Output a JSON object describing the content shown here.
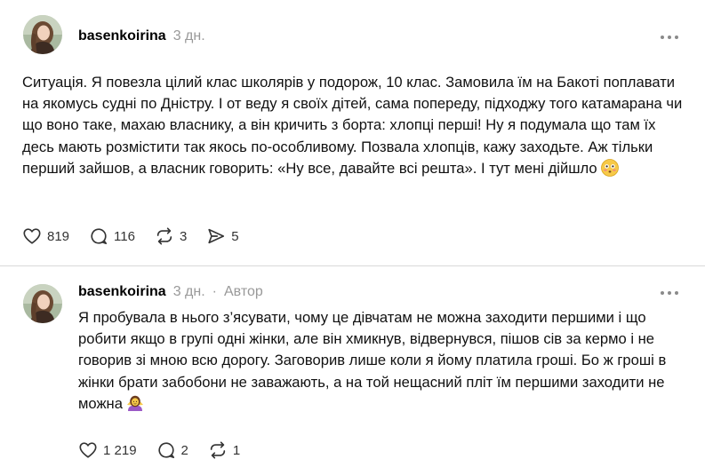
{
  "posts": [
    {
      "username": "basenkoirina",
      "time": "3 дн.",
      "text": "Ситуація. Я повезла цілий клас школярів у подорож, 10 клас. Замовила їм на Бакоті поплавати на якомусь судні по Дністру. І от веду я своїх дітей, сама попереду, підходжу того катамарана чи що воно таке, махаю власнику, а він кричить з борта: хлопці перші! Ну я подумала що там їх десь мають розмістити так якось по-особливому. Позвала хлопців, кажу заходьте. Аж тільки перший зайшов, а власник говорить: «Ну все, давайте всі решта». І тут мені дійшло",
      "emoji": "flushed-face-icon",
      "likes": "819",
      "replies": "116",
      "reposts": "3",
      "shares": "5"
    },
    {
      "username": "basenkoirina",
      "time": "3 дн.",
      "separator": "·",
      "author_label": "Автор",
      "text": "Я пробувала в нього з’ясувати, чому це дівчатам не можна заходити першими і що робити якщо в групі одні жінки, але він хмикнув, відвернувся, пішов сів за кермо і не говорив зі мною всю дорогу. Заговорив лише коли я йому платила гроші. Бо ж гроші в жінки брати забобони не заважають, а на той нещасний пліт їм першими заходити не можна",
      "emoji": "woman-shrugging-icon",
      "likes": "1 219",
      "replies": "2",
      "reposts": "1"
    }
  ],
  "colors": {
    "muted": "#999999",
    "divider": "#d9d9d9",
    "icon": "#333333"
  }
}
